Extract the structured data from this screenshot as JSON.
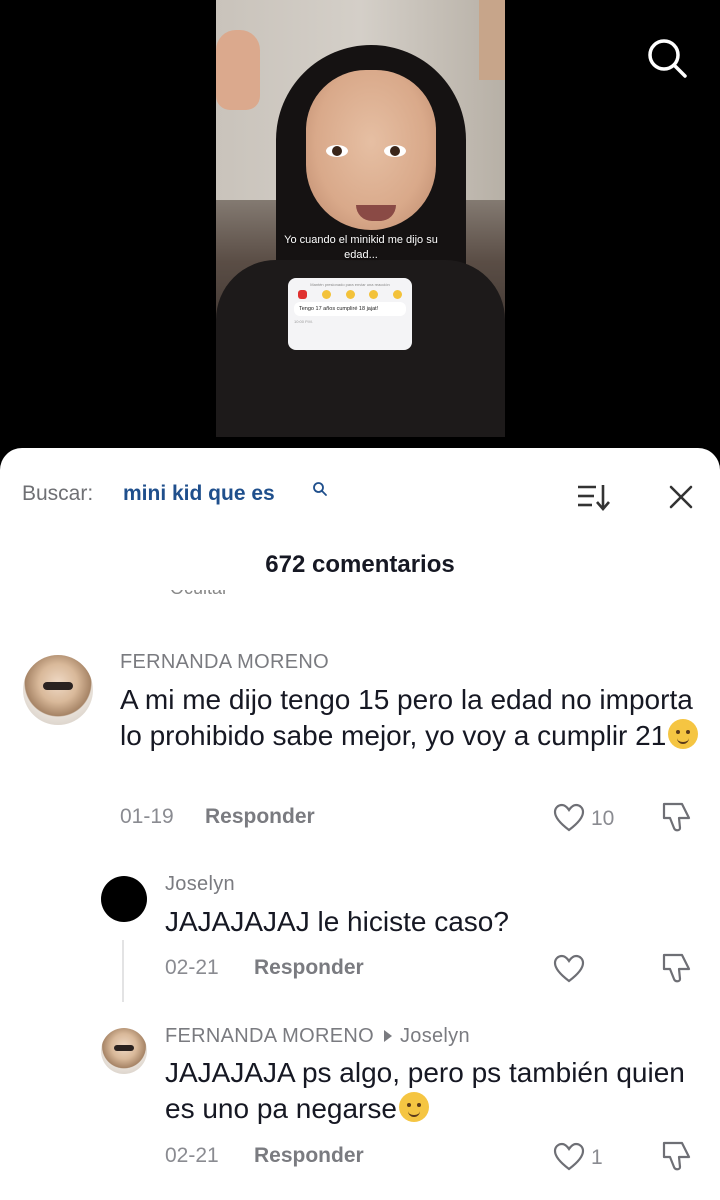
{
  "video": {
    "caption": "Yo cuando el minikid me dijo su edad...",
    "chat_header": "Mantén presionado para enviar una reacción",
    "chat_message": "Tengo 17 años cumpliré 18 jajat!",
    "chat_time": "10:00 P.M."
  },
  "search": {
    "prefix": "Buscar:",
    "term": "mini kid que es"
  },
  "comments_count": "672 comentarios",
  "cut_text": "Ocultar",
  "comments": [
    {
      "author": "FERNANDA MORENO",
      "text": "A mi me dijo tengo 15 pero la edad no importa lo prohibido sabe mejor, yo voy a cumplir 21",
      "date": "01-19",
      "reply_label": "Responder",
      "likes": "10"
    },
    {
      "author": "Joselyn",
      "text": "JAJAJAJAJ le hiciste caso?",
      "date": "02-21",
      "reply_label": "Responder",
      "likes": ""
    },
    {
      "author": "FERNANDA MORENO",
      "reply_to": "Joselyn",
      "text": "JAJAJAJA ps algo, pero ps también quien es uno pa negarse",
      "date": "02-21",
      "reply_label": "Responder",
      "likes": "1"
    }
  ],
  "icons": {
    "top_search": "search-icon",
    "sort": "sort-icon",
    "close": "close-icon",
    "like": "heart-icon",
    "dislike": "thumbs-down-icon"
  },
  "colors": {
    "search_term": "#1f4f8c",
    "text": "#161823",
    "muted": "#7a7b80"
  }
}
